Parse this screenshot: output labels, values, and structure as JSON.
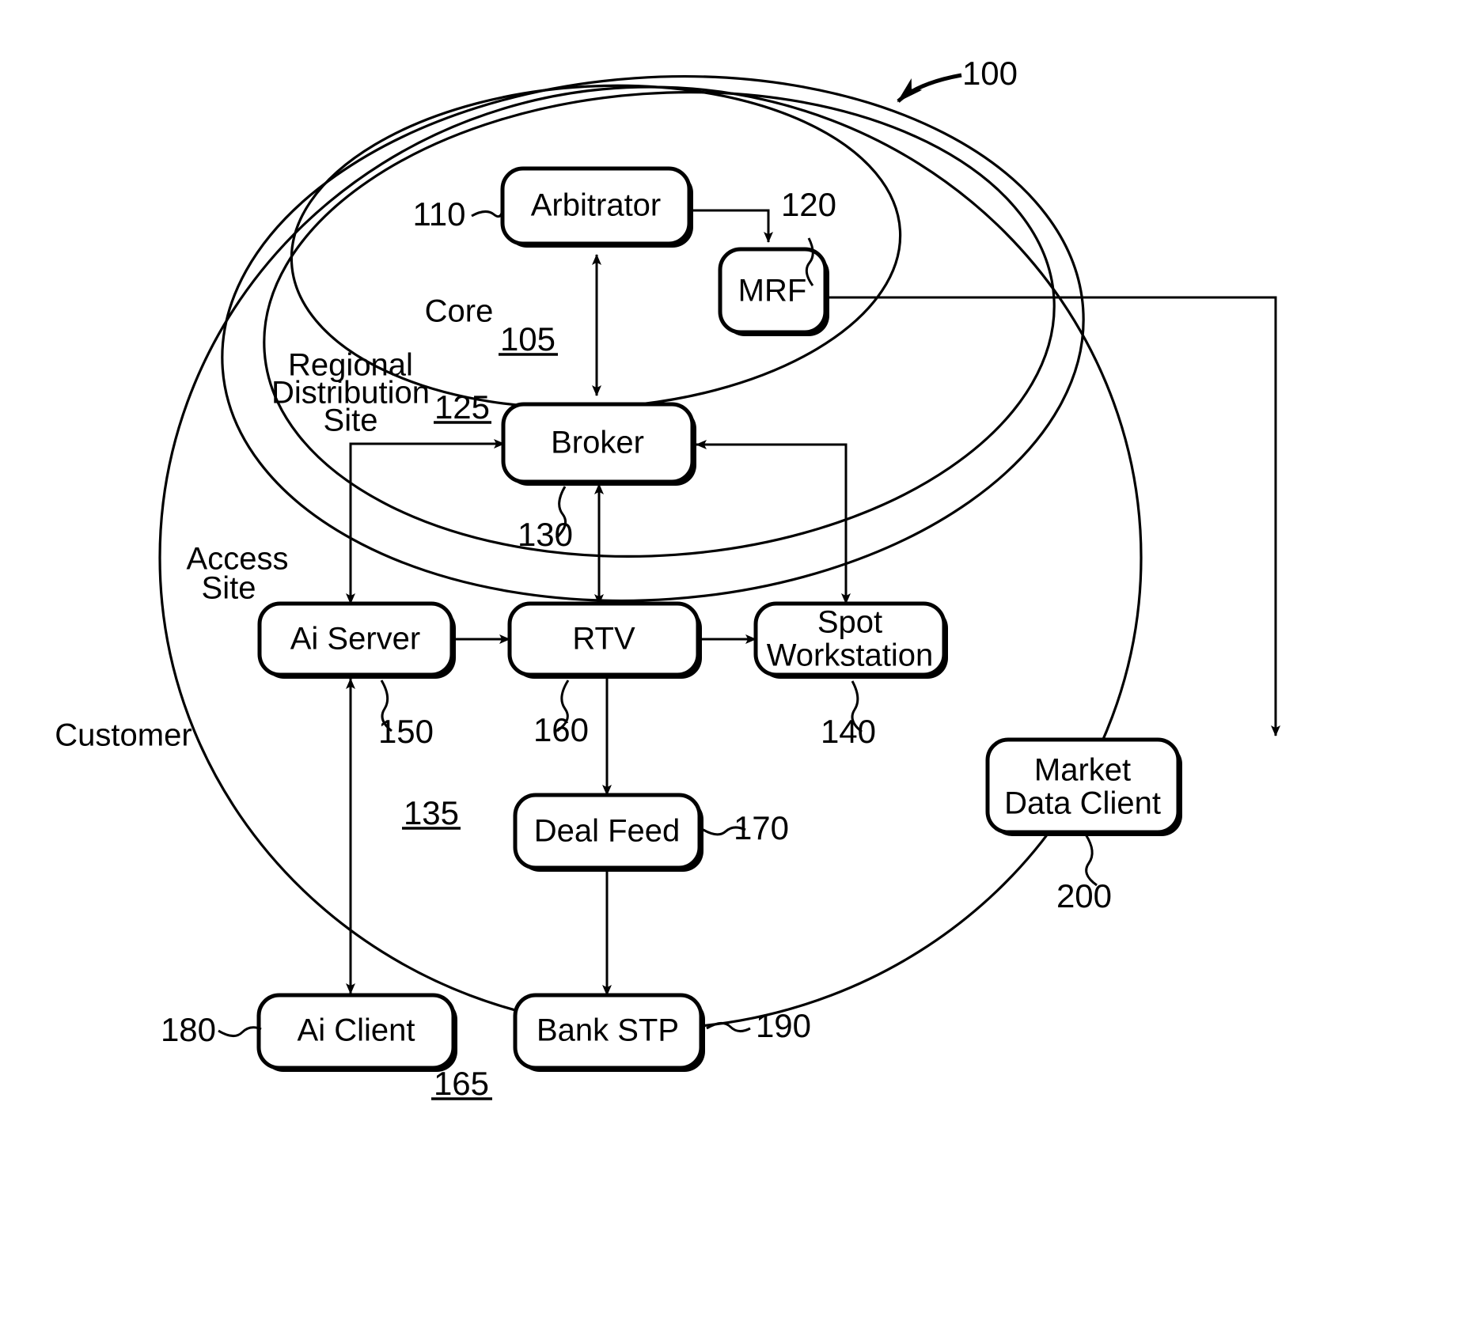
{
  "figure": {
    "title_ref": "100",
    "type": "patent-system-block-diagram"
  },
  "zones": [
    {
      "id": "core",
      "name": "Core",
      "ref": "105"
    },
    {
      "id": "rds",
      "name": "Regional\nDistribution\nSite",
      "ref": "125"
    },
    {
      "id": "access",
      "name": "Access\nSite",
      "ref": "135"
    },
    {
      "id": "customer",
      "name": "Customer",
      "ref": "165"
    }
  ],
  "zone_text": {
    "core": "Core",
    "core_ref": "105",
    "rds_line1": "Regional",
    "rds_line2": "Distribution",
    "rds_line3": "Site",
    "rds_ref": "125",
    "access_line1": "Access",
    "access_line2": "Site",
    "access_ref": "135",
    "customer": "Customer",
    "customer_ref": "165"
  },
  "nodes": [
    {
      "id": "arbitrator",
      "label": "Arbitrator",
      "ref": "110"
    },
    {
      "id": "mrf",
      "label": "MRF",
      "ref": "120"
    },
    {
      "id": "broker",
      "label": "Broker",
      "ref": "130"
    },
    {
      "id": "aiserver",
      "label": "Ai Server",
      "ref": "150"
    },
    {
      "id": "rtv",
      "label": "RTV",
      "ref": "160"
    },
    {
      "id": "spotws",
      "label_line1": "Spot",
      "label_line2": "Workstation",
      "label": "Spot Workstation",
      "ref": "140"
    },
    {
      "id": "dealfeed",
      "label": "Deal Feed",
      "ref": "170"
    },
    {
      "id": "aiclient",
      "label": "Ai Client",
      "ref": "180"
    },
    {
      "id": "bankstp",
      "label": "Bank STP",
      "ref": "190"
    },
    {
      "id": "mdclient",
      "label_line1": "Market",
      "label_line2": "Data Client",
      "label": "Market Data Client",
      "ref": "200"
    }
  ],
  "node_labels": {
    "arbitrator": "Arbitrator",
    "mrf": "MRF",
    "broker": "Broker",
    "aiserver": "Ai Server",
    "rtv": "RTV",
    "spotws_1": "Spot",
    "spotws_2": "Workstation",
    "dealfeed": "Deal Feed",
    "aiclient": "Ai Client",
    "bankstp": "Bank STP",
    "mdclient_1": "Market",
    "mdclient_2": "Data Client"
  },
  "ref_numbers": {
    "figure": "100",
    "arbitrator": "110",
    "mrf": "120",
    "broker": "130",
    "aiserver": "150",
    "rtv": "160",
    "spotws": "140",
    "dealfeed": "170",
    "aiclient": "180",
    "bankstp": "190",
    "mdclient": "200",
    "core": "105",
    "rds": "125",
    "access": "135",
    "customer": "165"
  },
  "connections": [
    {
      "from": "arbitrator",
      "to": "mrf",
      "direction": "one-way"
    },
    {
      "from": "broker",
      "to": "arbitrator",
      "direction": "two-way"
    },
    {
      "from": "mrf",
      "to": "mdclient",
      "direction": "one-way"
    },
    {
      "from": "aiserver",
      "to": "broker",
      "direction": "one-way"
    },
    {
      "from": "spotws",
      "to": "broker",
      "direction": "one-way"
    },
    {
      "from": "broker",
      "to": "aiserver",
      "direction": "one-way"
    },
    {
      "from": "broker",
      "to": "rtv",
      "direction": "two-way"
    },
    {
      "from": "broker",
      "to": "spotws",
      "direction": "one-way"
    },
    {
      "from": "aiserver",
      "to": "rtv",
      "direction": "two-way"
    },
    {
      "from": "rtv",
      "to": "spotws",
      "direction": "two-way"
    },
    {
      "from": "rtv",
      "to": "dealfeed",
      "direction": "one-way"
    },
    {
      "from": "dealfeed",
      "to": "bankstp",
      "direction": "one-way"
    },
    {
      "from": "aiclient",
      "to": "aiserver",
      "direction": "one-way"
    }
  ],
  "colors": {
    "stroke": "#000000",
    "fill": "#ffffff",
    "background": "#ffffff"
  }
}
